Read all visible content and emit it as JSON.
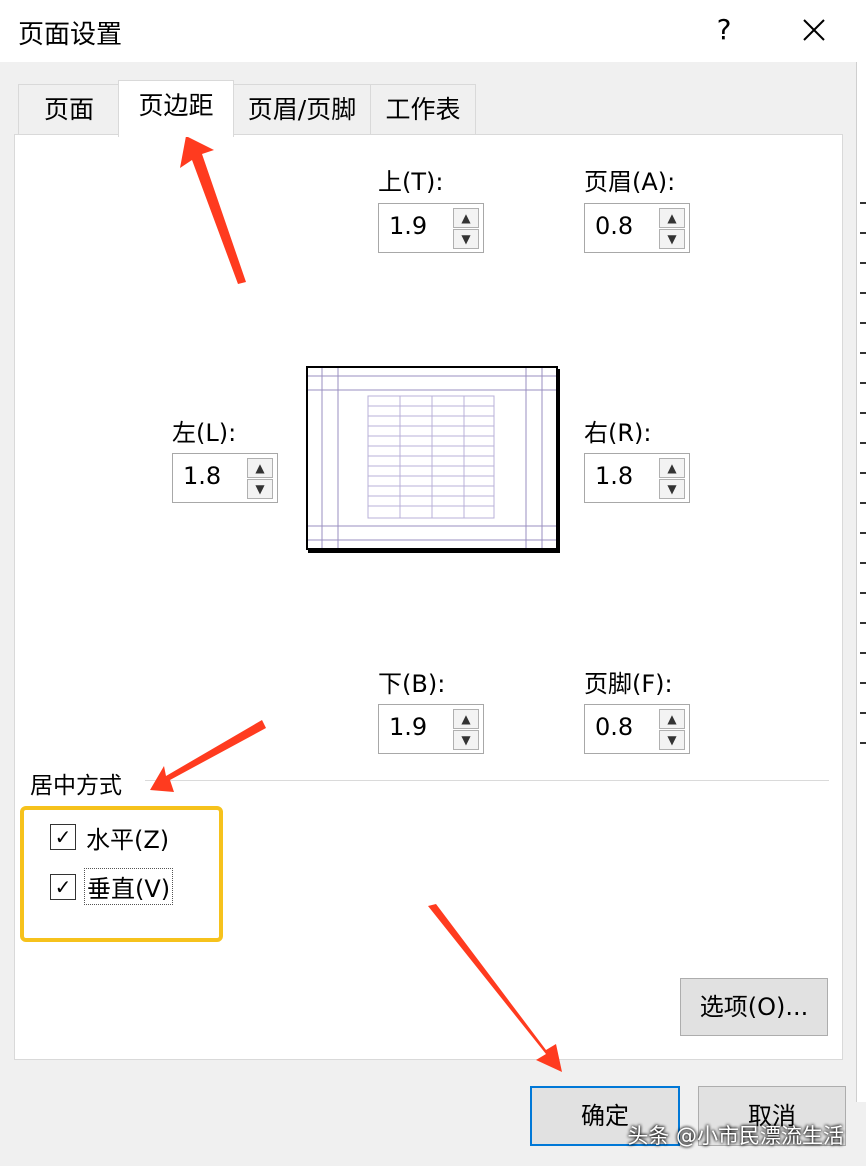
{
  "dialog": {
    "title": "页面设置",
    "help_label": "?",
    "close_label": "✕"
  },
  "tabs": [
    {
      "label": "页面",
      "active": false
    },
    {
      "label": "页边距",
      "active": true
    },
    {
      "label": "页眉/页脚",
      "active": false
    },
    {
      "label": "工作表",
      "active": false
    }
  ],
  "margins": {
    "top": {
      "label": "上(T):",
      "value": "1.9"
    },
    "header": {
      "label": "页眉(A):",
      "value": "0.8"
    },
    "left": {
      "label": "左(L):",
      "value": "1.8"
    },
    "right": {
      "label": "右(R):",
      "value": "1.8"
    },
    "bottom": {
      "label": "下(B):",
      "value": "1.9"
    },
    "footer": {
      "label": "页脚(F):",
      "value": "0.8"
    }
  },
  "centering": {
    "group_label": "居中方式",
    "horizontal": {
      "label": "水平(Z)",
      "checked": true
    },
    "vertical": {
      "label": "垂直(V)",
      "checked": true
    }
  },
  "buttons": {
    "options": "选项(O)...",
    "ok": "确定",
    "cancel": "取消"
  },
  "watermark": "头条 @小市民漂流生活",
  "colors": {
    "annotation_arrow": "#ff3b1f",
    "highlight_box": "#f6c21c",
    "default_button_border": "#0078d7"
  }
}
